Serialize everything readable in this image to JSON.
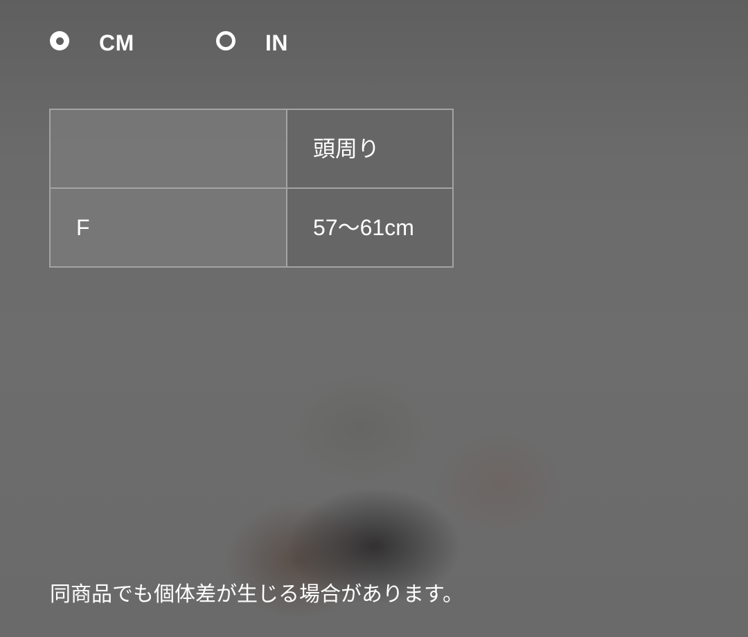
{
  "unit_toggle": {
    "selected": "CM",
    "options": [
      {
        "label": "CM",
        "checked": true
      },
      {
        "label": "IN",
        "checked": false
      }
    ]
  },
  "size_table": {
    "header": {
      "corner": "",
      "column": "頭周り"
    },
    "rows": [
      {
        "size": "F",
        "value": "57〜61cm"
      }
    ]
  },
  "note": "同商品でも個体差が生じる場合があります。"
}
